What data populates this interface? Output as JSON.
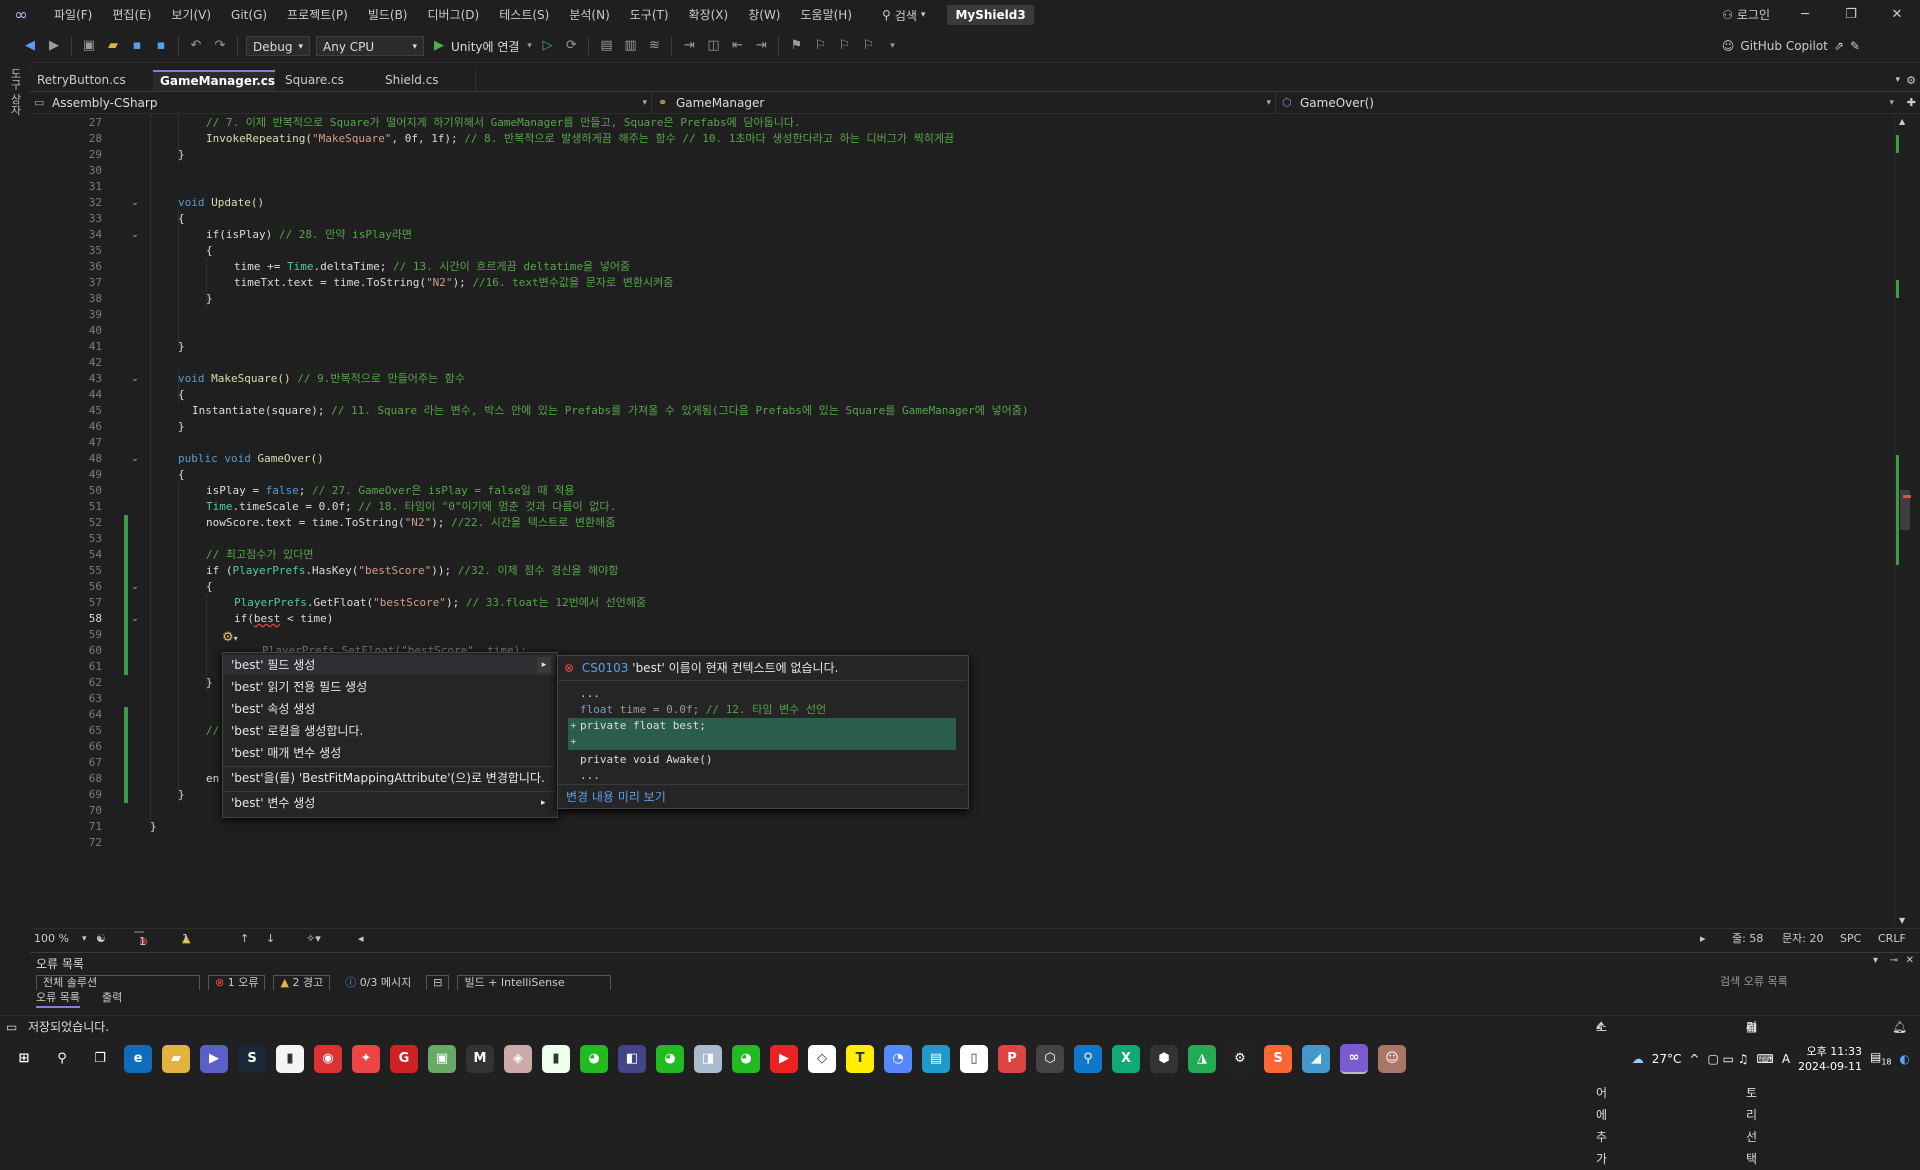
{
  "menubar": {
    "items": [
      "파일(F)",
      "편집(E)",
      "보기(V)",
      "Git(G)",
      "프로젝트(P)",
      "빌드(B)",
      "디버그(D)",
      "테스트(S)",
      "분석(N)",
      "도구(T)",
      "확장(X)",
      "창(W)",
      "도움말(H)"
    ],
    "search_label": "검색",
    "solution_name": "MyShield3",
    "login_label": "로그인"
  },
  "toolbar": {
    "config": "Debug",
    "platform": "Any CPU",
    "run_label": "Unity에 연결",
    "copilot_label": "GitHub Copilot"
  },
  "tabs": [
    {
      "label": "RetryButton.cs"
    },
    {
      "label": "GameManager.cs"
    },
    {
      "label": "Square.cs"
    },
    {
      "label": "Shield.cs"
    }
  ],
  "nav": {
    "project": "Assembly-CSharp",
    "class": "GameManager",
    "member": "GameOver()"
  },
  "editor": {
    "line_numbers": [
      "27",
      "28",
      "29",
      "30",
      "31",
      "32",
      "33",
      "34",
      "35",
      "36",
      "37",
      "38",
      "39",
      "40",
      "41",
      "42",
      "43",
      "44",
      "45",
      "46",
      "47",
      "48",
      "49",
      "50",
      "51",
      "52",
      "53",
      "54",
      "55",
      "56",
      "57",
      "58",
      "59",
      "60",
      "61",
      "62",
      "63",
      "64",
      "65",
      "66",
      "67",
      "68",
      "69",
      "70",
      "71",
      "72"
    ],
    "current_line": "58",
    "lines": {
      "l27": "// 7. 이제 반복적으로 Square가 떨어지게 하기위해서 GameManager를 만들고, Square은 Prefabs에 담아둡니다.",
      "l28_method": "InvokeRepeating",
      "l28_str": "\"MakeSquare\"",
      "l28_rest": ", 0f, 1f);",
      "l28_cm": "// 8. 반복적으로 발생하게끔 해주는 함수 // 10. 1초마다 생성한다라고 하는 디버그가 찍히게끔",
      "l29": "}",
      "l32_kw": "void",
      "l32_rest": "Update()",
      "l33": "{",
      "l34_a": "if(isPlay)",
      "l34_cm": "// 28. 만약 isPlay라면",
      "l35": "{",
      "l36_a": "time += ",
      "l36_ty": "Time",
      "l36_b": ".deltaTime;",
      "l36_cm": "// 13. 시간이 흐르게끔 deltatime을 넣어줌",
      "l37_a": "timeTxt.text = time.ToString(",
      "l37_str": "\"N2\"",
      "l37_b": ");",
      "l37_cm": "//16. text변수값을 문자로 변환시켜줌",
      "l38": "}",
      "l41": "}",
      "l43_kw": "void",
      "l43_rest": "MakeSquare()",
      "l43_cm": "// 9.반복적으로 만들어주는 함수",
      "l44": "{",
      "l45_a": "Instantiate(square);",
      "l45_cm": "// 11. Square 라는 변수, 박스 안에 있는 Prefabs를 가져올 수 있게됨(그다음 Prefabs에 있는 Square를 GameManager에 넣어줌)",
      "l46": "}",
      "l48_kw1": "public",
      "l48_kw2": "void",
      "l48_rest": "GameOver()",
      "l49": "{",
      "l50_a": "isPlay = ",
      "l50_kw": "false",
      "l50_b": ";",
      "l50_cm": "// 27. GameOver은 isPlay = false일 때 적용",
      "l51_ty": "Time",
      "l51_a": ".timeScale = 0.0f;",
      "l51_cm": "// 18. 타임이 \"0\"이기에 멈춘 것과 다름이 없다.",
      "l52_a": "nowScore.text = time.ToString(",
      "l52_str": "\"N2\"",
      "l52_b": ");",
      "l52_cm": "//22. 시간을 텍스트로 변환해줌",
      "l54_cm": "// 최고점수가 있다면",
      "l55_a": "if (",
      "l55_ty": "PlayerPrefs",
      "l55_b": ".HasKey(",
      "l55_str": "\"bestScore\"",
      "l55_c": "));",
      "l55_cm": "//32. 이제 점수 경신을 해야함",
      "l56": "{",
      "l57_ty": "PlayerPrefs",
      "l57_a": ".GetFloat(",
      "l57_str": "\"bestScore\"",
      "l57_b": ");",
      "l57_cm": "// 33.float는 12번에서 선언해줌",
      "l58_a": "if(",
      "l58_err": "best",
      "l58_b": " < time)",
      "l60": "PlayerPrefs.SetFloat(\"bestScore\", time);",
      "l61": "}",
      "l62": "}",
      "l65": "//",
      "l68": "en",
      "l69": "}",
      "l71": "}"
    }
  },
  "quick_actions": {
    "items": [
      "'best' 필드 생성",
      "'best' 읽기 전용 필드 생성",
      "'best' 속성 생성",
      "'best' 로컬을 생성합니다.",
      "'best' 매개 변수 생성",
      "'best'을(를) 'BestFitMappingAttribute'(으)로 변경합니다.",
      "'best' 변수 생성"
    ],
    "preview": {
      "error_code": "CS0103",
      "error_msg": "'best' 이름이 현재 컨텍스트에 없습니다.",
      "line1": "...",
      "line2": "float time = 0.0f; // 12. 타임 변수 선언",
      "line3": "private float best;",
      "line4": "",
      "line5": "private void Awake()",
      "line6": "...",
      "footer": "변경 내용 미리 보기"
    }
  },
  "editor_status": {
    "zoom": "100 %",
    "errors": "1",
    "warnings": "1",
    "line": "줄: 58",
    "col": "문자: 20",
    "spc": "SPC",
    "eol": "CRLF"
  },
  "error_panel": {
    "title": "오류 목록",
    "scope": "전체 솔루션",
    "errors_chip": "1 오류",
    "warnings_chip": "2 경고",
    "messages_chip": "0/3 메시지",
    "build_filter": "빌드 + IntelliSense",
    "search_placeholder": "검색 오류 목록",
    "tab1": "오류 목록",
    "tab2": "출력"
  },
  "statusbar": {
    "saved": "저장되었습니다.",
    "source_control": "소스 제어에 추가",
    "repo": "리포지토리 선택"
  },
  "taskbar": {
    "temperature": "27°C",
    "time": "오후 11:33",
    "date": "2024-09-11",
    "notif_count": "18",
    "ime": "A"
  },
  "colors": {
    "accent": "#8b7bd8",
    "change_bar": "#3f9a4a",
    "error": "#f44747",
    "preview_add": "#2a5d4b"
  }
}
